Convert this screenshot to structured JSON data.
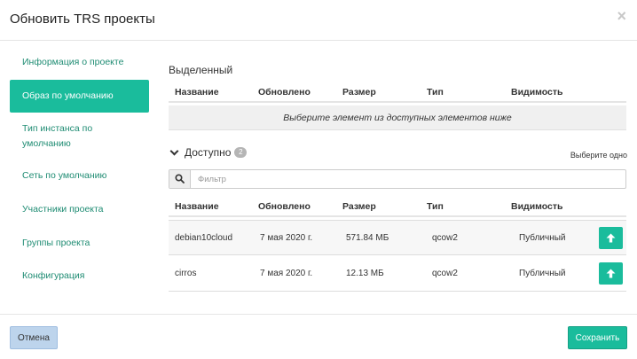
{
  "modal": {
    "title": "Обновить TRS проекты",
    "close_label": "×"
  },
  "nav": {
    "items": [
      {
        "label": "Информация о проекте"
      },
      {
        "label": "Образ по умолчанию"
      },
      {
        "label": "Тип инстанса по умолчанию"
      },
      {
        "label": "Сеть по умолчанию"
      },
      {
        "label": "Участники проекта"
      },
      {
        "label": "Группы проекта"
      },
      {
        "label": "Конфигурация"
      }
    ],
    "active_index": 1
  },
  "selected": {
    "title": "Выделенный",
    "columns": [
      "Название",
      "Обновлено",
      "Размер",
      "Тип",
      "Видимость"
    ],
    "empty_text": "Выберите элемент из доступных элементов ниже"
  },
  "available": {
    "title": "Доступно",
    "count": "2",
    "choose_one": "Выберите одно",
    "filter_placeholder": "Фильтр",
    "columns": [
      "Название",
      "Обновлено",
      "Размер",
      "Тип",
      "Видимость"
    ],
    "rows": [
      {
        "name": "debian10cloud",
        "updated": "7 мая 2020 г.",
        "size": "571.84 МБ",
        "type": "qcow2",
        "visibility": "Публичный"
      },
      {
        "name": "cirros",
        "updated": "7 мая 2020 г.",
        "size": "12.13 МБ",
        "type": "qcow2",
        "visibility": "Публичный"
      }
    ]
  },
  "footer": {
    "cancel_label": "Отмена",
    "save_label": "Сохранить"
  },
  "colors": {
    "accent": "#1abc9c",
    "cancel_bg": "#bdd4ec",
    "link": "#1f8c73"
  },
  "icons": {
    "search": "search-icon",
    "upload": "arrow-up-icon",
    "close": "close-icon",
    "chevron": "chevron-down-icon"
  }
}
